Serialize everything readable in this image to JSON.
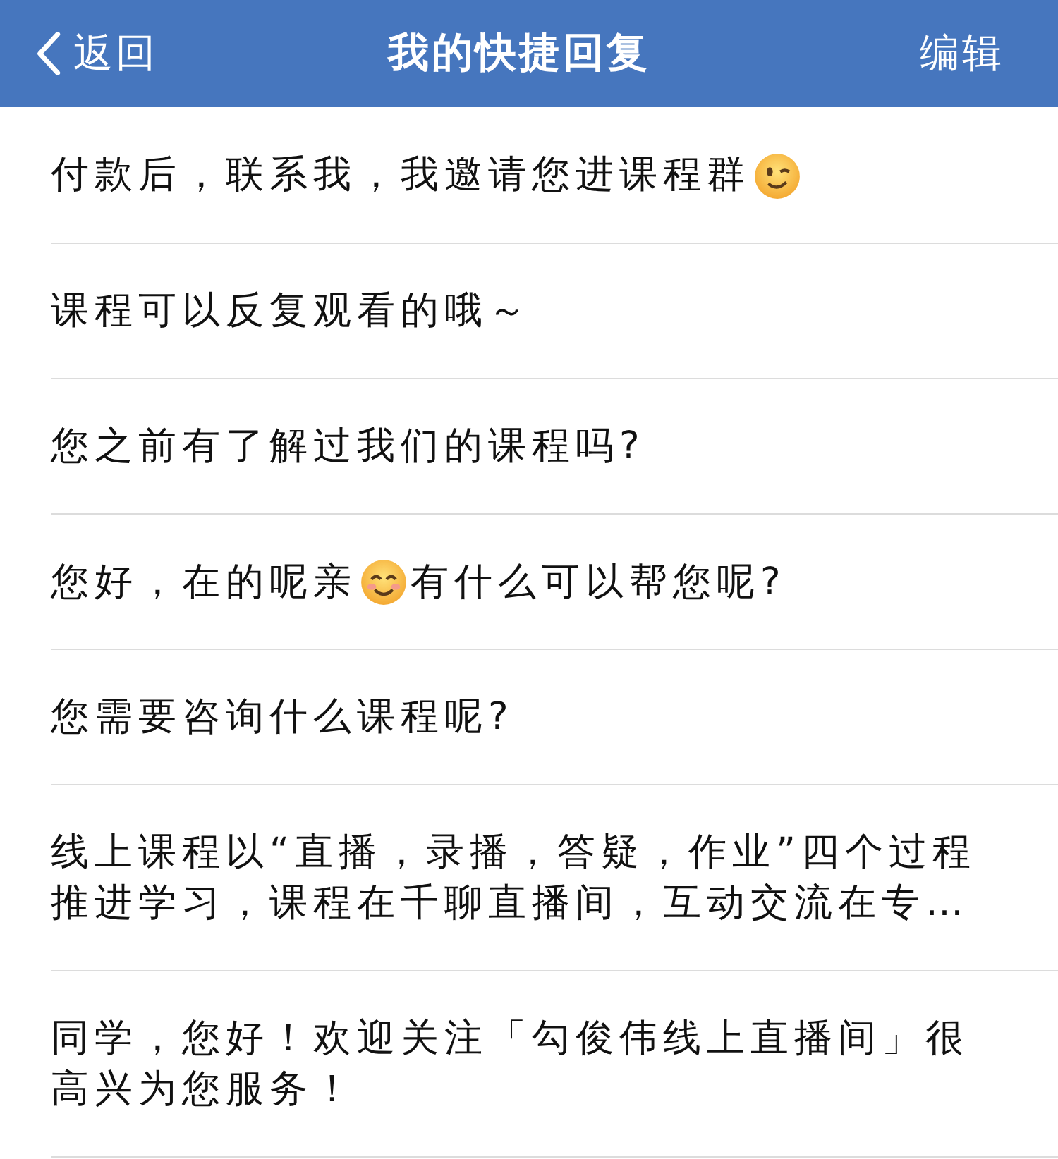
{
  "nav": {
    "back": "返回",
    "title": "我的快捷回复",
    "edit": "编辑"
  },
  "replies": [
    {
      "segments": [
        {
          "kind": "text",
          "text": "付款后，联系我，我邀请您进课程群"
        },
        {
          "kind": "wink"
        }
      ]
    },
    {
      "segments": [
        {
          "kind": "text",
          "text": "课程可以反复观看的哦～"
        }
      ]
    },
    {
      "segments": [
        {
          "kind": "text",
          "text": "您之前有了解过我们的课程吗?"
        }
      ]
    },
    {
      "segments": [
        {
          "kind": "text",
          "text": "您好，在的呢亲"
        },
        {
          "kind": "smile"
        },
        {
          "kind": "text",
          "text": "有什么可以帮您呢?"
        }
      ]
    },
    {
      "segments": [
        {
          "kind": "text",
          "text": "您需要咨询什么课程呢?"
        }
      ]
    },
    {
      "segments": [
        {
          "kind": "text",
          "text": "线上课程以“直播，录播，答疑，作业”四个过程推进学习，课程在千聊直播间，互动交流在专…"
        }
      ]
    },
    {
      "segments": [
        {
          "kind": "text",
          "text": "同学，您好！欢迎关注「勾俊伟线上直播间」很高兴为您服务！"
        }
      ]
    }
  ]
}
